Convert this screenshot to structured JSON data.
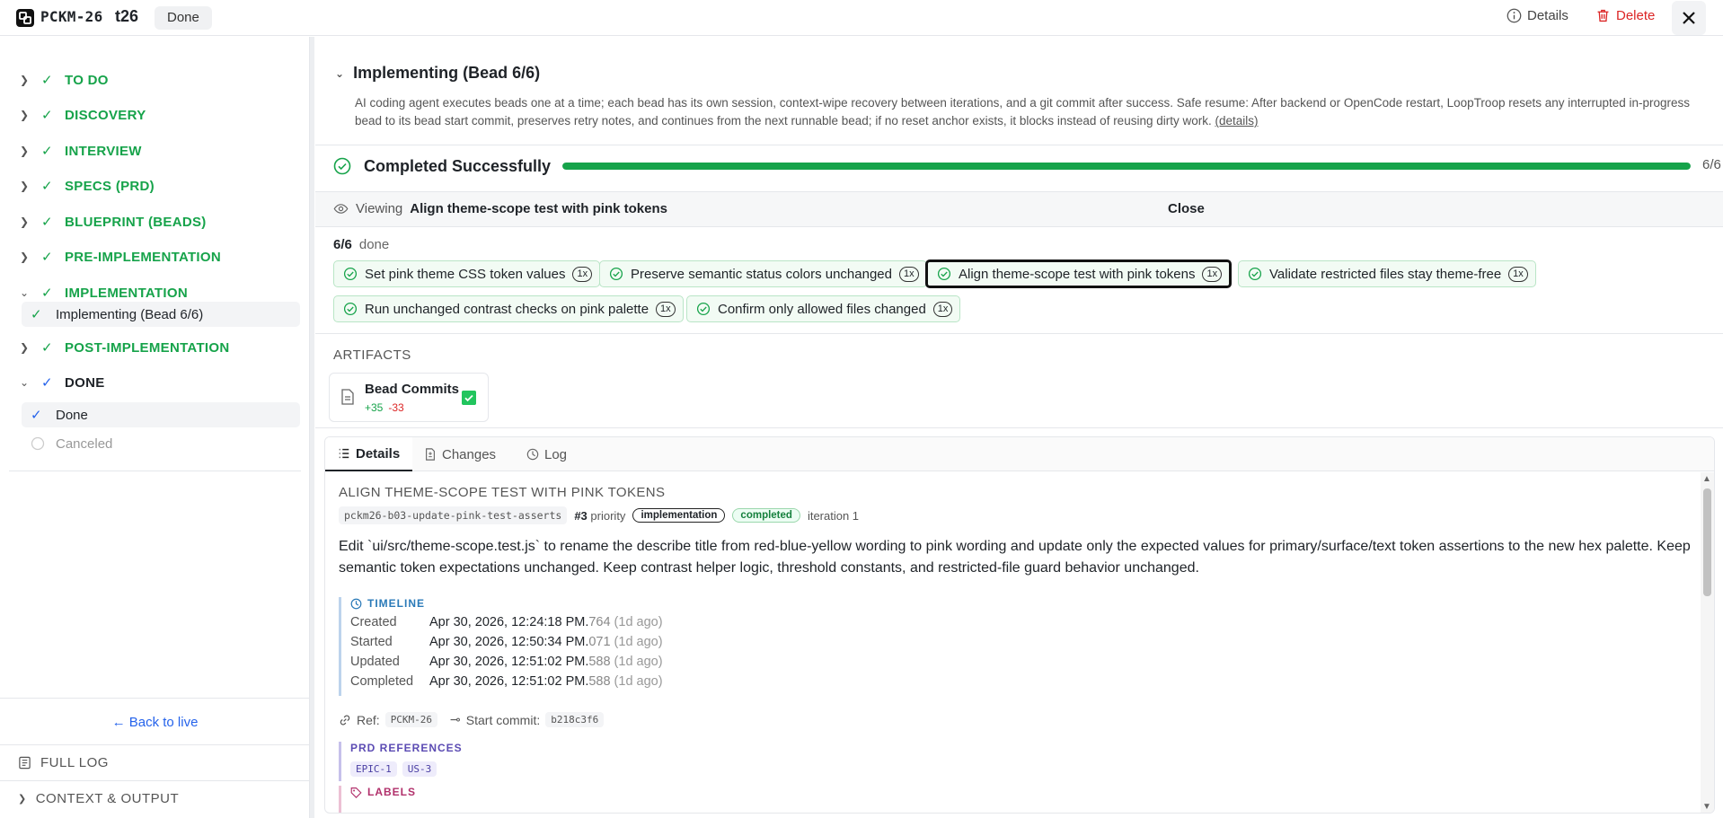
{
  "header": {
    "project_code": "PCKM-26",
    "ticket_id": "t26",
    "status": "Done",
    "details_label": "Details",
    "delete_label": "Delete"
  },
  "sidebar": {
    "phases": [
      {
        "label": "TO DO"
      },
      {
        "label": "DISCOVERY"
      },
      {
        "label": "INTERVIEW"
      },
      {
        "label": "SPECS (PRD)"
      },
      {
        "label": "BLUEPRINT (BEADS)"
      },
      {
        "label": "PRE-IMPLEMENTATION"
      },
      {
        "label": "IMPLEMENTATION",
        "sub": "Implementing (Bead 6/6)"
      },
      {
        "label": "POST-IMPLEMENTATION"
      },
      {
        "label": "DONE",
        "subs": [
          "Done",
          "Canceled"
        ]
      }
    ],
    "back_to_live": "← Back to live",
    "full_log": "FULL LOG",
    "context_output": "CONTEXT & OUTPUT"
  },
  "stage": {
    "title": "Implementing (Bead 6/6)",
    "description": "AI coding agent executes beads one at a time; each bead has its own session, context-wipe recovery between iterations, and a git commit after success. Safe resume: After backend or OpenCode restart, LoopTroop resets any interrupted in-progress bead to its bead start commit, preserves retry notes, and continues from the next runnable bead; if no reset anchor exists, it blocks instead of reusing dirty work.",
    "details_link": "(details)",
    "completed_label": "Completed Successfully",
    "progress_count": "6/6",
    "progress_fraction": 1.0
  },
  "viewing": {
    "prefix": "Viewing",
    "bead_name": "Align theme-scope test with pink tokens",
    "close_label": "Close"
  },
  "beads": {
    "count": "6/6",
    "count_suffix": "done",
    "items": [
      {
        "label": "Set pink theme CSS token values",
        "mult": "1x"
      },
      {
        "label": "Preserve semantic status colors unchanged",
        "mult": "1x"
      },
      {
        "label": "Align theme-scope test with pink tokens",
        "mult": "1x"
      },
      {
        "label": "Validate restricted files stay theme-free",
        "mult": "1x"
      },
      {
        "label": "Run unchanged contrast checks on pink palette",
        "mult": "1x"
      },
      {
        "label": "Confirm only allowed files changed",
        "mult": "1x"
      }
    ]
  },
  "artifacts": {
    "heading": "ARTIFACTS",
    "card": {
      "name": "Bead Commits",
      "added": "+35",
      "removed": "-33"
    }
  },
  "tabs": {
    "details": "Details",
    "changes": "Changes",
    "log": "Log"
  },
  "detail": {
    "title": "ALIGN THEME-SCOPE TEST WITH PINK TOKENS",
    "slug": "pckm26-b03-update-pink-test-asserts",
    "priority_num": "#3",
    "priority_word": "priority",
    "tag_impl": "implementation",
    "tag_status": "completed",
    "iteration": "iteration 1",
    "description": "Edit `ui/src/theme-scope.test.js` to rename the describe title from red-blue-yellow wording to pink wording and update only the expected values for primary/surface/text token assertions to the new hex palette. Keep semantic token expectations unchanged. Keep contrast helper logic, threshold constants, and restricted-file guard behavior unchanged.",
    "timeline_heading": "TIMELINE",
    "timeline": [
      {
        "k": "Created",
        "v": "Apr 30, 2026, 12:24:18 PM.",
        "ms": "764",
        "ago": "(1d ago)"
      },
      {
        "k": "Started",
        "v": "Apr 30, 2026, 12:50:34 PM.",
        "ms": "071",
        "ago": "(1d ago)"
      },
      {
        "k": "Updated",
        "v": "Apr 30, 2026, 12:51:02 PM.",
        "ms": "588",
        "ago": "(1d ago)"
      },
      {
        "k": "Completed",
        "v": "Apr 30, 2026, 12:51:02 PM.",
        "ms": "588",
        "ago": "(1d ago)"
      }
    ],
    "ref_label": "Ref:",
    "ref_value": "PCKM-26",
    "start_commit_label": "Start commit:",
    "start_commit_value": "b218c3f6",
    "prd_heading": "PRD REFERENCES",
    "prd_refs": [
      "EPIC-1",
      "US-3"
    ],
    "labels_heading": "LABELS"
  },
  "colors": {
    "accent_green": "#16a34a",
    "danger": "#dc2626",
    "link_blue": "#2563eb"
  }
}
